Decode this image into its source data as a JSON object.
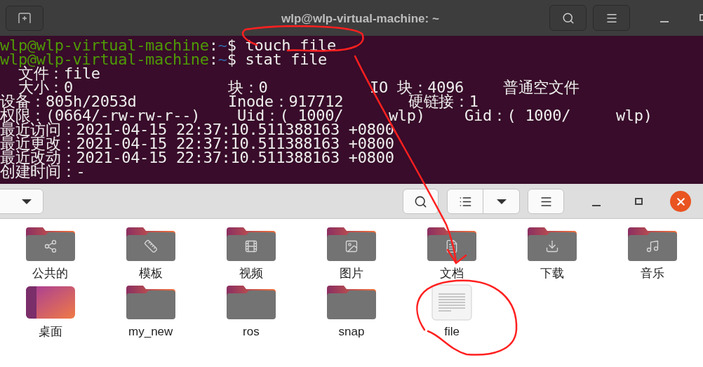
{
  "terminal": {
    "title": "wlp@wlp-virtual-machine: ~",
    "lines": [
      {
        "kind": "prompt",
        "segments": [
          {
            "kind": "user",
            "text": "wlp@wlp-virtual-machine"
          },
          {
            "kind": "plain",
            "text": ":"
          },
          {
            "kind": "path",
            "text": "~"
          },
          {
            "kind": "plain",
            "text": "$ touch file"
          }
        ]
      },
      {
        "kind": "prompt",
        "segments": [
          {
            "kind": "user",
            "text": "wlp@wlp-virtual-machine"
          },
          {
            "kind": "plain",
            "text": ":"
          },
          {
            "kind": "path",
            "text": "~"
          },
          {
            "kind": "plain",
            "text": "$ stat file"
          }
        ]
      },
      {
        "kind": "output",
        "cells": [
          "  文件：file"
        ]
      },
      {
        "kind": "output",
        "cells": [
          "  大小：0",
          "块：0",
          "IO 块：4096",
          "普通空文件"
        ]
      },
      {
        "kind": "output",
        "cells": [
          "设备：805h/2053d",
          "Inode：917712",
          "硬链接：1"
        ]
      },
      {
        "kind": "output",
        "cells": [
          "权限：(0664/-rw-rw-r--)",
          "Uid：( 1000/     wlp)",
          "Gid：( 1000/     wlp)"
        ]
      },
      {
        "kind": "output",
        "cells": [
          "最近访问：2021-04-15 22:37:10.511388163 +0800"
        ]
      },
      {
        "kind": "output",
        "cells": [
          "最近更改：2021-04-15 22:37:10.511388163 +0800"
        ]
      },
      {
        "kind": "output",
        "cells": [
          "最近改动：2021-04-15 22:37:10.511388163 +0800"
        ]
      },
      {
        "kind": "output",
        "cells": [
          "创建时间：-"
        ]
      }
    ]
  },
  "files": {
    "items": [
      {
        "label": "公共的",
        "kind": "share"
      },
      {
        "label": "模板",
        "kind": "template"
      },
      {
        "label": "视频",
        "kind": "video"
      },
      {
        "label": "图片",
        "kind": "picture"
      },
      {
        "label": "文档",
        "kind": "document"
      },
      {
        "label": "下载",
        "kind": "download"
      },
      {
        "label": "音乐",
        "kind": "music"
      },
      {
        "label": "桌面",
        "kind": "desktop"
      },
      {
        "label": "my_new",
        "kind": "folder"
      },
      {
        "label": "ros",
        "kind": "folder"
      },
      {
        "label": "snap",
        "kind": "folder"
      },
      {
        "label": "file",
        "kind": "file"
      }
    ]
  }
}
